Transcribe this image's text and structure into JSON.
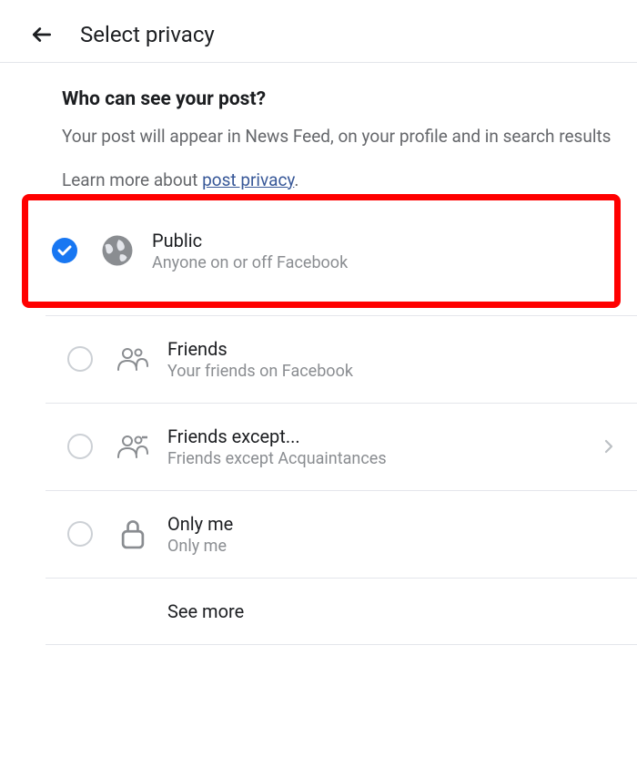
{
  "header": {
    "title": "Select privacy"
  },
  "section": {
    "question": "Who can see your post?",
    "description": "Your post will appear in News Feed, on your profile and in search results",
    "learn_prefix": "Learn more about ",
    "learn_link": "post privacy",
    "learn_suffix": "."
  },
  "options": [
    {
      "title": "Public",
      "sub": "Anyone on or off Facebook",
      "selected": true,
      "icon": "globe",
      "chevron": false,
      "highlight": true
    },
    {
      "title": "Friends",
      "sub": "Your friends on Facebook",
      "selected": false,
      "icon": "friends",
      "chevron": false,
      "highlight": false
    },
    {
      "title": "Friends except...",
      "sub": "Friends except Acquaintances",
      "selected": false,
      "icon": "friends-except",
      "chevron": true,
      "highlight": false
    },
    {
      "title": "Only me",
      "sub": "Only me",
      "selected": false,
      "icon": "lock",
      "chevron": false,
      "highlight": false
    }
  ],
  "see_more": "See more"
}
